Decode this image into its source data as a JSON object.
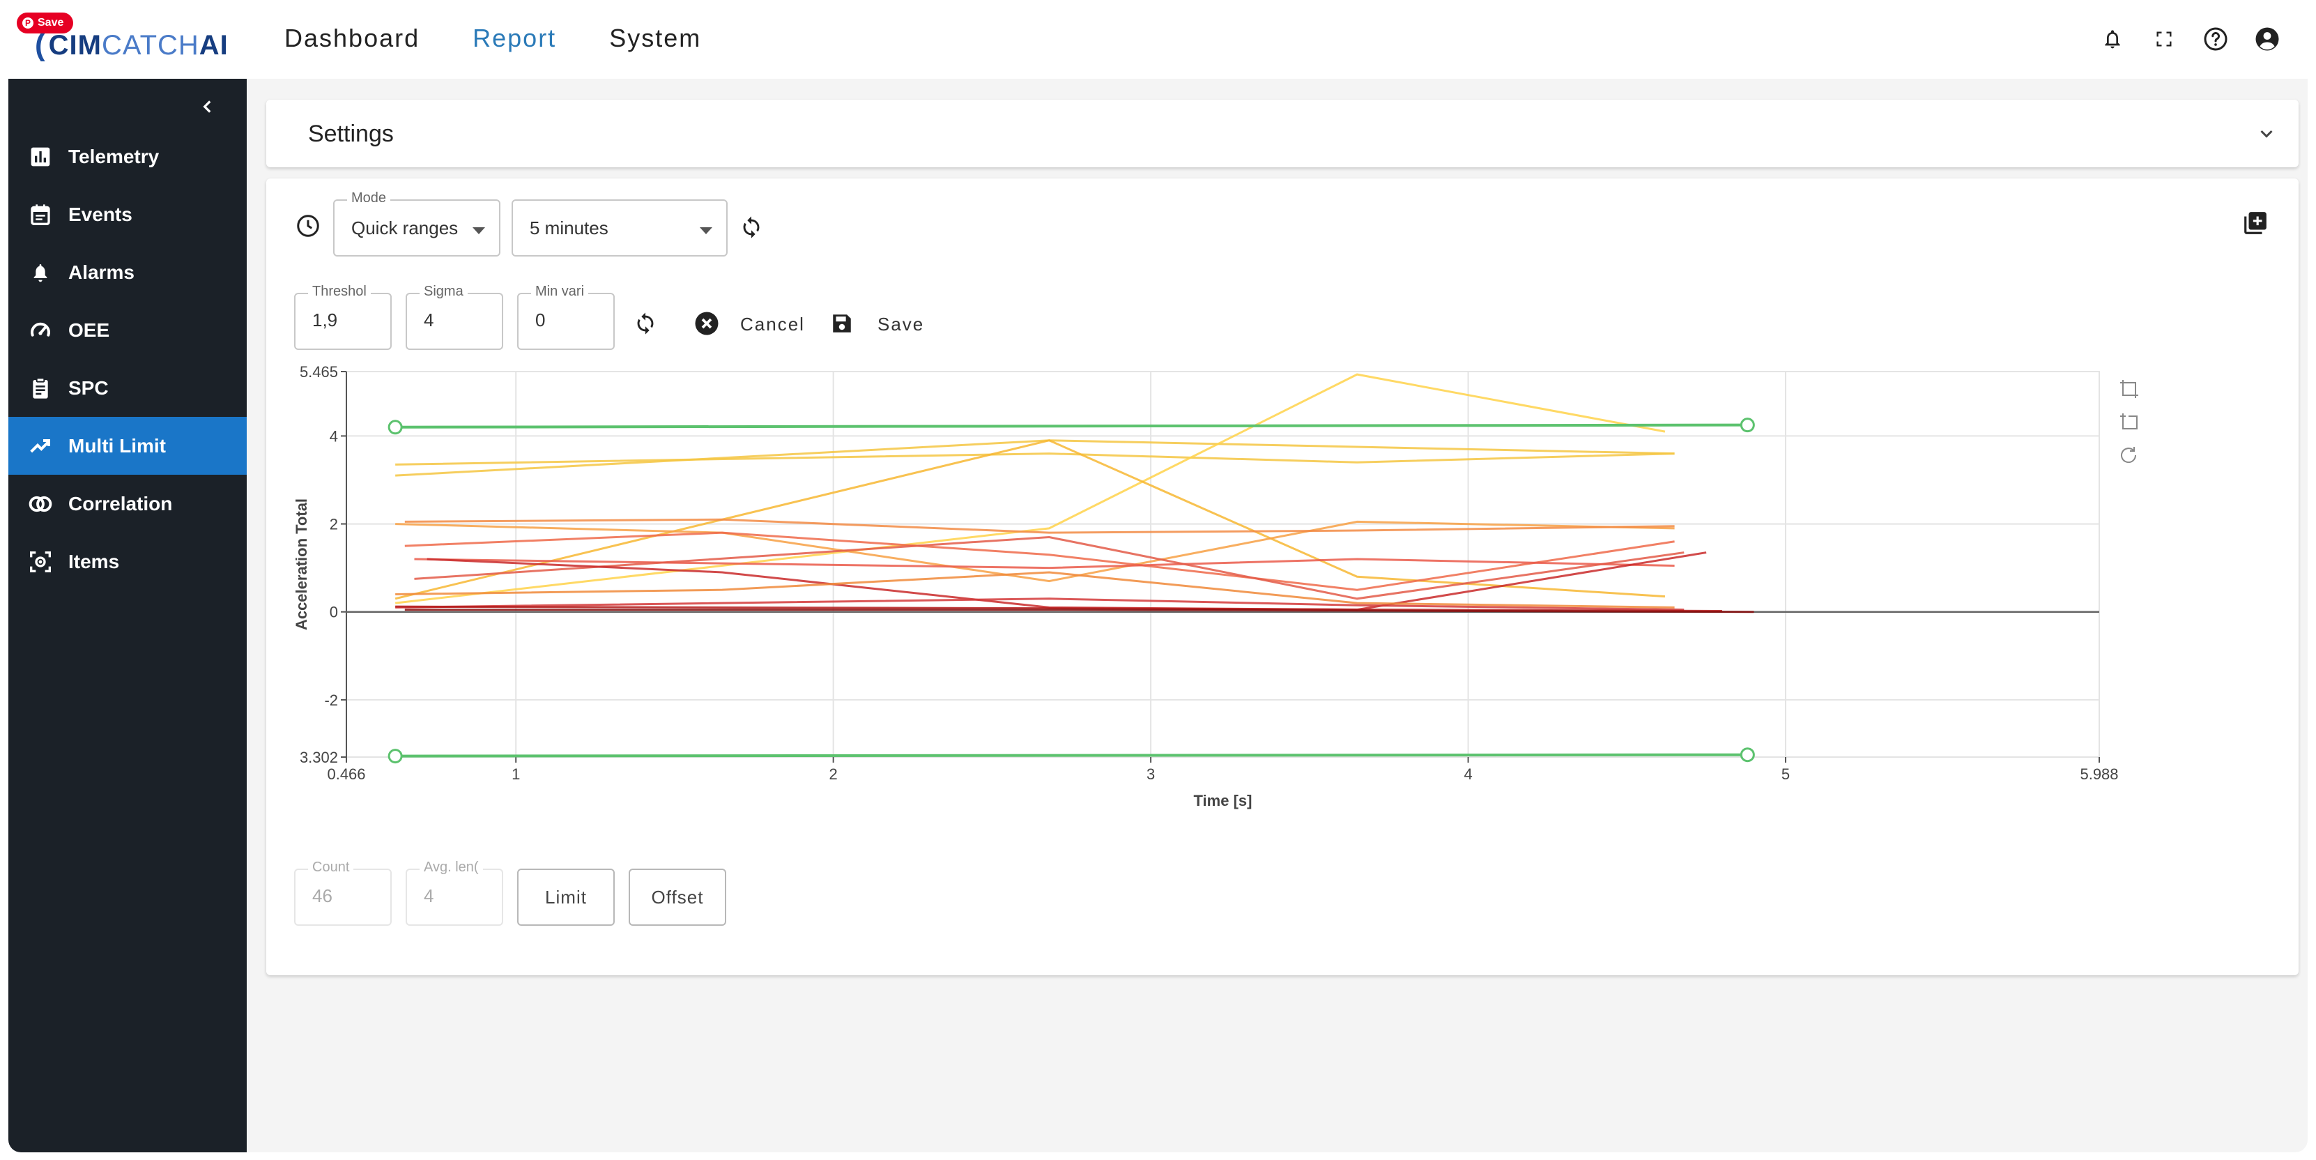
{
  "pin": {
    "label": "Save"
  },
  "header": {
    "logo": {
      "part1": "CIM",
      "part2": "CATCH",
      "part3": "AI"
    },
    "nav": [
      {
        "label": "Dashboard",
        "active": false
      },
      {
        "label": "Report",
        "active": true
      },
      {
        "label": "System",
        "active": false
      }
    ],
    "icons": [
      "bell-icon",
      "fullscreen-icon",
      "help-icon",
      "account-icon"
    ]
  },
  "sidebar": {
    "items": [
      {
        "label": "Telemetry",
        "icon": "bar-chart-icon",
        "active": false
      },
      {
        "label": "Events",
        "icon": "calendar-icon",
        "active": false
      },
      {
        "label": "Alarms",
        "icon": "bell-alert-icon",
        "active": false
      },
      {
        "label": "OEE",
        "icon": "speedometer-icon",
        "active": false
      },
      {
        "label": "SPC",
        "icon": "clipboard-icon",
        "active": false
      },
      {
        "label": "Multi Limit",
        "icon": "trending-up-icon",
        "active": true
      },
      {
        "label": "Correlation",
        "icon": "rings-icon",
        "active": false
      },
      {
        "label": "Items",
        "icon": "scan-item-icon",
        "active": false
      }
    ]
  },
  "settings": {
    "title": "Settings"
  },
  "controls": {
    "mode": {
      "legend": "Mode",
      "value": "Quick ranges"
    },
    "range": {
      "value": "5 minutes"
    },
    "threshold": {
      "legend": "Threshol",
      "value": "1,9"
    },
    "sigma": {
      "legend": "Sigma",
      "value": "4"
    },
    "min_variation": {
      "legend": "Min vari",
      "value": "0"
    },
    "cancel_label": "Cancel",
    "save_label": "Save"
  },
  "stats": {
    "count": {
      "legend": "Count",
      "value": "46"
    },
    "avg_length": {
      "legend": "Avg. len(",
      "value": "4"
    },
    "limit_label": "Limit",
    "offset_label": "Offset"
  },
  "chart_data": {
    "type": "line",
    "xlabel": "Time [s]",
    "ylabel": "Acceleration Total",
    "xlim": [
      0.466,
      5.988
    ],
    "ylim": [
      -3.302,
      5.465
    ],
    "x_ticks": [
      "0.466",
      "1",
      "2",
      "3",
      "4",
      "5",
      "5.988"
    ],
    "y_ticks": [
      "5.465",
      "4",
      "2",
      "0",
      "-2",
      "3.302"
    ],
    "grid": true,
    "colors": {
      "limit": "#5cc26e",
      "axis": "#666666",
      "grid": "#e4e4e4"
    },
    "limits": [
      {
        "x": [
          0.62,
          4.88
        ],
        "y": [
          4.2,
          4.25
        ]
      },
      {
        "x": [
          0.62,
          4.88
        ],
        "y": [
          -3.28,
          -3.25
        ]
      }
    ],
    "series": [
      {
        "color": "#f5c542",
        "x": [
          0.62,
          2.68,
          4.65
        ],
        "y": [
          3.1,
          3.9,
          3.6
        ]
      },
      {
        "color": "#f5c542",
        "x": [
          0.62,
          2.68,
          3.65,
          4.65
        ],
        "y": [
          3.35,
          3.6,
          3.4,
          3.6
        ]
      },
      {
        "color": "#ffd24a",
        "x": [
          0.62,
          2.68,
          3.65,
          4.62
        ],
        "y": [
          0.2,
          1.9,
          5.4,
          4.1
        ]
      },
      {
        "color": "#f7b733",
        "x": [
          0.62,
          2.68,
          3.65,
          4.62
        ],
        "y": [
          0.3,
          3.9,
          0.8,
          0.35
        ]
      },
      {
        "color": "#f7a044",
        "x": [
          0.62,
          1.65,
          2.68,
          3.65,
          4.65
        ],
        "y": [
          2.0,
          1.8,
          0.7,
          2.05,
          1.9
        ]
      },
      {
        "color": "#f28b44",
        "x": [
          0.65,
          1.65,
          2.68,
          3.65,
          4.65
        ],
        "y": [
          2.05,
          2.1,
          1.8,
          1.85,
          1.95
        ]
      },
      {
        "color": "#ef6a4a",
        "x": [
          0.65,
          1.65,
          2.68,
          3.65,
          4.65
        ],
        "y": [
          1.5,
          1.8,
          1.3,
          0.5,
          1.6
        ]
      },
      {
        "color": "#ea5a4a",
        "x": [
          0.68,
          2.68,
          3.65,
          4.65
        ],
        "y": [
          1.2,
          1.0,
          1.2,
          1.05
        ]
      },
      {
        "color": "#e35a48",
        "x": [
          0.68,
          2.68,
          3.65,
          4.68
        ],
        "y": [
          0.75,
          1.7,
          0.3,
          1.35
        ]
      },
      {
        "color": "#c92a2a",
        "x": [
          0.72,
          1.65,
          2.68,
          3.65,
          4.75
        ],
        "y": [
          1.2,
          0.9,
          0.1,
          0.05,
          1.35
        ]
      },
      {
        "color": "#d33a3a",
        "x": [
          0.62,
          2.68,
          3.65,
          4.68
        ],
        "y": [
          0.1,
          0.3,
          0.15,
          0.05
        ]
      },
      {
        "color": "#b31a1a",
        "x": [
          0.62,
          2.68,
          4.8
        ],
        "y": [
          0.12,
          0.08,
          0.02
        ]
      },
      {
        "color": "#8a0e0e",
        "x": [
          0.65,
          2.68,
          4.9
        ],
        "y": [
          0.05,
          0.05,
          0.0
        ]
      },
      {
        "color": "#f08a3a",
        "x": [
          0.62,
          1.65,
          2.68,
          3.65,
          4.65
        ],
        "y": [
          0.4,
          0.5,
          0.9,
          0.2,
          0.1
        ]
      }
    ]
  }
}
